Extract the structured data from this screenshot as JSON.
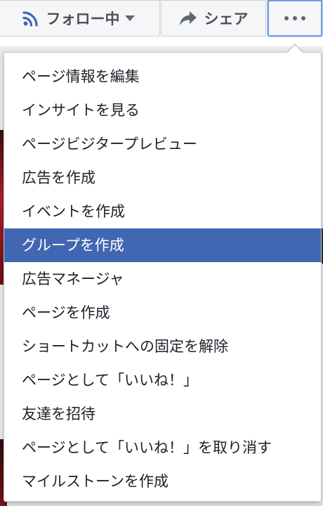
{
  "colors": {
    "accent": "#4267b2",
    "button_text": "#4b4f56",
    "menu_text": "#1d2129",
    "focus_border": "#6e9de3"
  },
  "action_bar": {
    "follow_button": {
      "label": "フォロー中",
      "icon": "rss-feed-icon",
      "dropdown_icon": "caret-down-icon"
    },
    "share_button": {
      "label": "シェア",
      "icon": "share-arrow-icon"
    },
    "more_button": {
      "icon": "more-dots-icon"
    }
  },
  "menu": {
    "active_index": 5,
    "items": [
      {
        "label": "ページ情報を編集"
      },
      {
        "label": "インサイトを見る"
      },
      {
        "label": "ページビジタープレビュー"
      },
      {
        "label": "広告を作成"
      },
      {
        "label": "イベントを作成"
      },
      {
        "label": "グループを作成"
      },
      {
        "label": "広告マネージャ"
      },
      {
        "label": "ページを作成"
      },
      {
        "label": "ショートカットへの固定を解除"
      },
      {
        "label": "ページとして「いいね！」"
      },
      {
        "label": "友達を招待"
      },
      {
        "label": "ページとして「いいね！」を取り消す"
      },
      {
        "label": "マイルストーンを作成"
      }
    ]
  }
}
